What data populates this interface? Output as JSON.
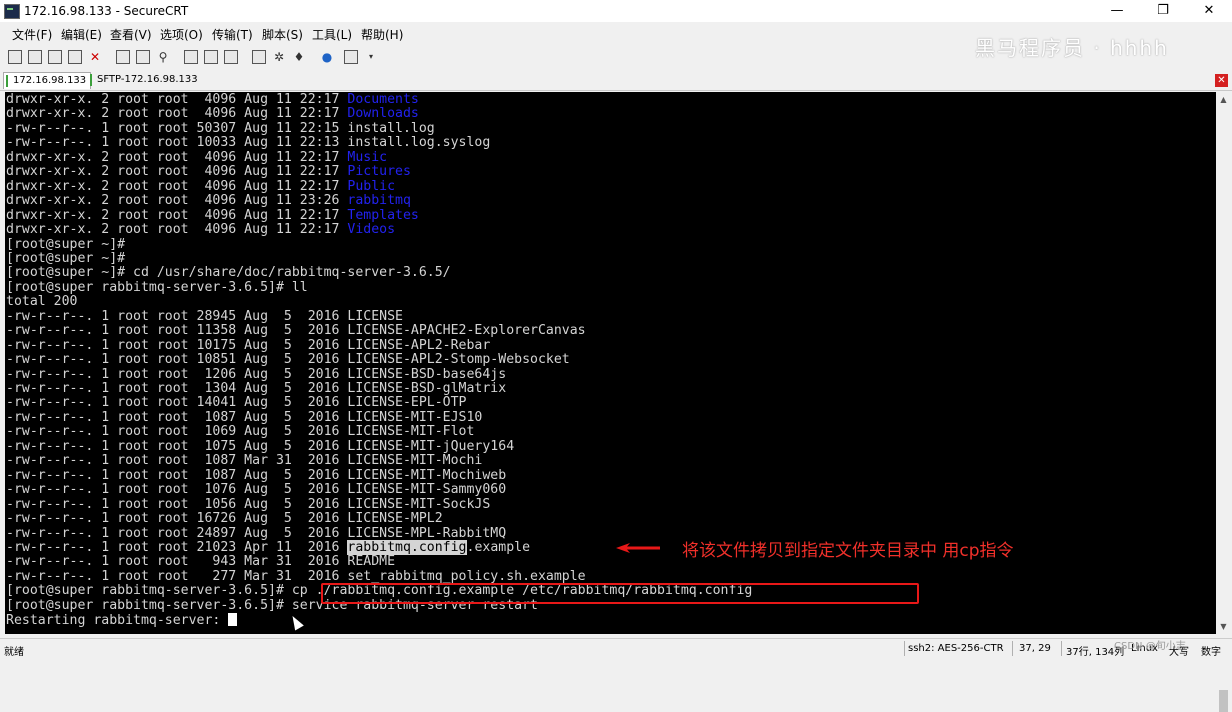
{
  "window": {
    "title": "172.16.98.133 - SecureCRT",
    "minimize_glyph": "—",
    "maximize_glyph": "❐",
    "close_glyph": "✕"
  },
  "menu": [
    "文件(F)",
    "编辑(E)",
    "查看(V)",
    "选项(O)",
    "传输(T)",
    "脚本(S)",
    "工具(L)",
    "帮助(H)"
  ],
  "watermark": "黑马程序员 · hhhh",
  "tabs": [
    "172.16.98.133",
    "SFTP-172.16.98.133"
  ],
  "tab_close_glyph": "✕",
  "terminal": {
    "lines": [
      {
        "prefix": "drwxr-xr-x. 2 root root  4096 Aug 11 22:17 ",
        "name": "Documents"
      },
      {
        "prefix": "drwxr-xr-x. 2 root root  4096 Aug 11 22:17 ",
        "name": "Downloads"
      },
      {
        "prefix": "-rw-r--r--. 1 root root 50307 Aug 11 22:15 install.log"
      },
      {
        "prefix": "-rw-r--r--. 1 root root 10033 Aug 11 22:13 install.log.syslog"
      },
      {
        "prefix": "drwxr-xr-x. 2 root root  4096 Aug 11 22:17 ",
        "name": "Music"
      },
      {
        "prefix": "drwxr-xr-x. 2 root root  4096 Aug 11 22:17 ",
        "name": "Pictures"
      },
      {
        "prefix": "drwxr-xr-x. 2 root root  4096 Aug 11 22:17 ",
        "name": "Public"
      },
      {
        "prefix": "drwxr-xr-x. 2 root root  4096 Aug 11 23:26 ",
        "name": "rabbitmq"
      },
      {
        "prefix": "drwxr-xr-x. 2 root root  4096 Aug 11 22:17 ",
        "name": "Templates"
      },
      {
        "prefix": "drwxr-xr-x. 2 root root  4096 Aug 11 22:17 ",
        "name": "Videos"
      },
      {
        "prefix": "[root@super ~]#"
      },
      {
        "prefix": "[root@super ~]#"
      },
      {
        "prefix": "[root@super ~]# cd /usr/share/doc/rabbitmq-server-3.6.5/"
      },
      {
        "prefix": "[root@super rabbitmq-server-3.6.5]# ll"
      },
      {
        "prefix": "total 200"
      },
      {
        "prefix": "-rw-r--r--. 1 root root 28945 Aug  5  2016 LICENSE"
      },
      {
        "prefix": "-rw-r--r--. 1 root root 11358 Aug  5  2016 LICENSE-APACHE2-ExplorerCanvas"
      },
      {
        "prefix": "-rw-r--r--. 1 root root 10175 Aug  5  2016 LICENSE-APL2-Rebar"
      },
      {
        "prefix": "-rw-r--r--. 1 root root 10851 Aug  5  2016 LICENSE-APL2-Stomp-Websocket"
      },
      {
        "prefix": "-rw-r--r--. 1 root root  1206 Aug  5  2016 LICENSE-BSD-base64js"
      },
      {
        "prefix": "-rw-r--r--. 1 root root  1304 Aug  5  2016 LICENSE-BSD-glMatrix"
      },
      {
        "prefix": "-rw-r--r--. 1 root root 14041 Aug  5  2016 LICENSE-EPL-OTP"
      },
      {
        "prefix": "-rw-r--r--. 1 root root  1087 Aug  5  2016 LICENSE-MIT-EJS10"
      },
      {
        "prefix": "-rw-r--r--. 1 root root  1069 Aug  5  2016 LICENSE-MIT-Flot"
      },
      {
        "prefix": "-rw-r--r--. 1 root root  1075 Aug  5  2016 LICENSE-MIT-jQuery164"
      },
      {
        "prefix": "-rw-r--r--. 1 root root  1087 Mar 31  2016 LICENSE-MIT-Mochi"
      },
      {
        "prefix": "-rw-r--r--. 1 root root  1087 Aug  5  2016 LICENSE-MIT-Mochiweb"
      },
      {
        "prefix": "-rw-r--r--. 1 root root  1076 Aug  5  2016 LICENSE-MIT-Sammy060"
      },
      {
        "prefix": "-rw-r--r--. 1 root root  1056 Aug  5  2016 LICENSE-MIT-SockJS"
      },
      {
        "prefix": "-rw-r--r--. 1 root root 16726 Aug  5  2016 LICENSE-MPL2"
      },
      {
        "prefix": "-rw-r--r--. 1 root root 24897 Aug  5  2016 LICENSE-MPL-RabbitMQ"
      },
      {
        "prefix": "-rw-r--r--. 1 root root 21023 Apr 11  2016 ",
        "highlight": "rabbitmq.config",
        "suffix": ".example"
      },
      {
        "prefix": "-rw-r--r--. 1 root root   943 Mar 31  2016 README"
      },
      {
        "prefix": "-rw-r--r--. 1 root root   277 Mar 31  2016 set_rabbitmq_policy.sh.example"
      },
      {
        "prefix": "[root@super rabbitmq-server-3.6.5]# cp ./rabbitmq.config.example /etc/rabbitmq/rabbitmq.config"
      },
      {
        "prefix": "[root@super rabbitmq-server-3.6.5]# service rabbitmq-server restart"
      },
      {
        "prefix": "Restarting rabbitmq-server: ",
        "cursor": true
      }
    ]
  },
  "annotation": {
    "text": "将该文件拷贝到指定文件夹目录中 用cp指令"
  },
  "statusbar": {
    "ready": "就绪",
    "cipher": "ssh2: AES-256-CTR",
    "cursor_pos": "37, 29",
    "size": "37行, 134列",
    "term": "Linux",
    "csdn": "CSDN @旬小志",
    "caps": "大写",
    "num": "数字"
  },
  "colors": {
    "terminal_bg": "#000000",
    "terminal_fg": "#d4d4d4",
    "dir_color": "#2222ee",
    "annotation_red": "#e81818"
  }
}
